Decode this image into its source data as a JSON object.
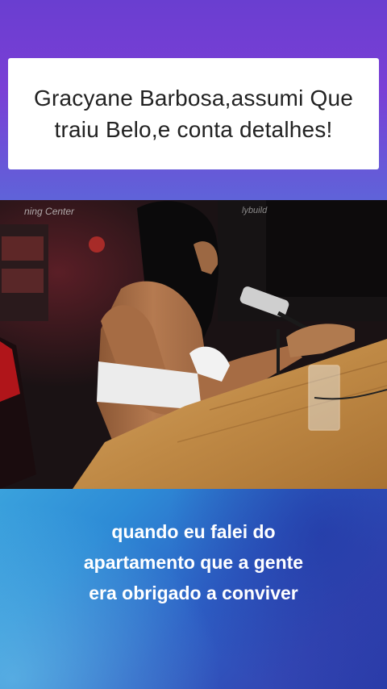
{
  "title": "Gracyane Barbosa,assumi Que traiu Belo,e conta detalhes!",
  "video": {
    "watermark_left": "ning Center",
    "watermark_right": "lybuild"
  },
  "caption": {
    "lines": [
      "quando eu falei do",
      "apartamento que a gente",
      "era obrigado a conviver"
    ]
  },
  "colors": {
    "top_gradient": "#7a3fd6",
    "bottom_gradient": "#2d5ec4",
    "caption_text": "#ffffff",
    "title_text": "#222222"
  }
}
